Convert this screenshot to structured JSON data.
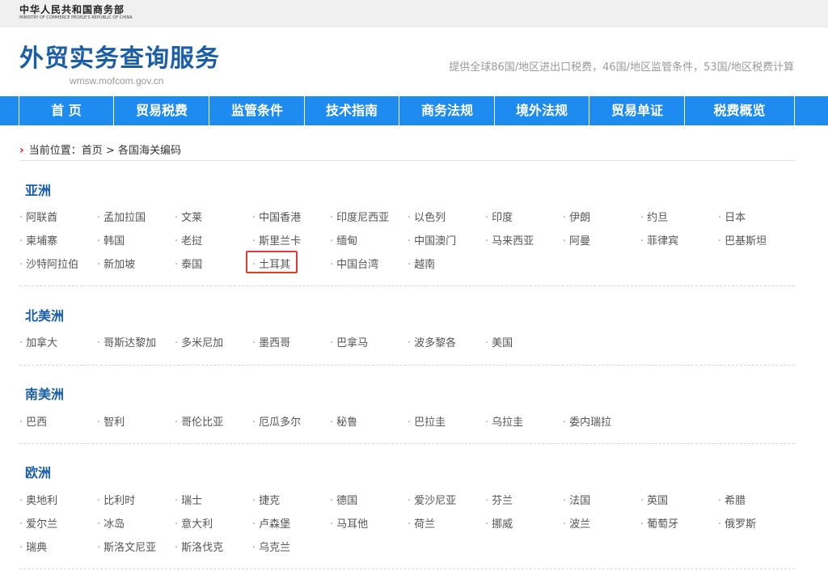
{
  "ministry": {
    "name_cn": "中华人民共和国商务部",
    "name_en": "MINISTRY OF COMMERCE PEOPLE'S REPUBLIC OF CHINA"
  },
  "site": {
    "title": "外贸实务查询服务",
    "domain": "wmsw.mofcom.gov.cn",
    "tagline": "提供全球86国/地区进出口税费，46国/地区监管条件，53国/地区税费计算"
  },
  "nav": [
    "首 页",
    "贸易税费",
    "监管条件",
    "技术指南",
    "商务法规",
    "境外法规",
    "贸易单证",
    "税费概览"
  ],
  "breadcrumb": {
    "arrow": "›",
    "label": "当前位置：",
    "home": "首页",
    "separator": ">",
    "current": "各国海关编码"
  },
  "regions": [
    {
      "name": "亚洲",
      "countries": [
        "阿联酋",
        "孟加拉国",
        "文莱",
        "中国香港",
        "印度尼西亚",
        "以色列",
        "印度",
        "伊朗",
        "约旦",
        "日本",
        "柬埔寨",
        "韩国",
        "老挝",
        "斯里兰卡",
        "缅甸",
        "中国澳门",
        "马来西亚",
        "阿曼",
        "菲律宾",
        "巴基斯坦",
        "沙特阿拉伯",
        "新加坡",
        "泰国",
        "土耳其",
        "中国台湾",
        "越南"
      ]
    },
    {
      "name": "北美洲",
      "countries": [
        "加拿大",
        "哥斯达黎加",
        "多米尼加",
        "墨西哥",
        "巴拿马",
        "波多黎各",
        "美国"
      ]
    },
    {
      "name": "南美洲",
      "countries": [
        "巴西",
        "智利",
        "哥伦比亚",
        "厄瓜多尔",
        "秘鲁",
        "巴拉圭",
        "乌拉圭",
        "委内瑞拉"
      ]
    },
    {
      "name": "欧洲",
      "countries": [
        "奥地利",
        "比利时",
        "瑞士",
        "捷克",
        "德国",
        "爱沙尼亚",
        "芬兰",
        "法国",
        "英国",
        "希腊",
        "爱尔兰",
        "冰岛",
        "意大利",
        "卢森堡",
        "马耳他",
        "荷兰",
        "挪威",
        "波兰",
        "葡萄牙",
        "俄罗斯",
        "瑞典",
        "斯洛文尼亚",
        "斯洛伐克",
        "乌克兰"
      ]
    }
  ],
  "highlighted_country": "土耳其",
  "colors": {
    "brand_blue": "#1a5ea8",
    "nav_blue": "#1d8bf0",
    "highlight_red": "#e33b2f"
  }
}
